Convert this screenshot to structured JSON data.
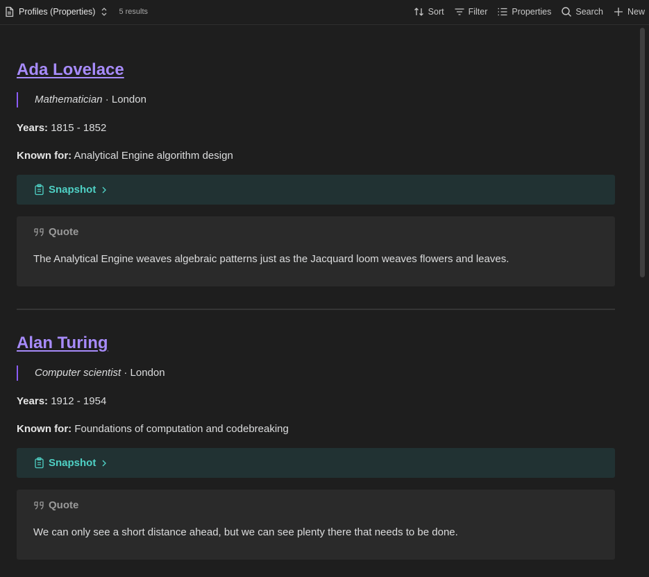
{
  "toolbar": {
    "view_title": "Profiles (Properties)",
    "results": "5 results",
    "sort_label": "Sort",
    "filter_label": "Filter",
    "properties_label": "Properties",
    "search_label": "Search",
    "new_label": "New"
  },
  "entries": [
    {
      "name": "Ada Lovelace",
      "role": "Mathematician",
      "location": " · London",
      "years_label": "Years:",
      "years": " 1815 - 1852",
      "known_label": "Known for:",
      "known": " Analytical Engine algorithm design",
      "snapshot_label": "Snapshot",
      "quote_label": "Quote",
      "quote": "The Analytical Engine weaves algebraic patterns just as the Jacquard loom weaves flowers and leaves."
    },
    {
      "name": "Alan Turing",
      "role": "Computer scientist",
      "location": " · London",
      "years_label": "Years:",
      "years": " 1912 - 1954",
      "known_label": "Known for:",
      "known": " Foundations of computation and codebreaking",
      "snapshot_label": "Snapshot",
      "quote_label": "Quote",
      "quote": "We can only see a short distance ahead, but we can see plenty there that needs to be done."
    }
  ],
  "colors": {
    "background": "#1e1e1e",
    "link": "#a78bfa",
    "accent_bar": "#8b5cf6",
    "snapshot_bg": "#213233",
    "snapshot_text": "#4fd1c5",
    "quote_bg": "#2a2a2a"
  },
  "icons": [
    "document-icon",
    "chevron-updown-icon",
    "sort-icon",
    "filter-icon",
    "properties-icon",
    "search-icon",
    "plus-icon",
    "clipboard-icon",
    "chevron-right-icon",
    "quote-icon"
  ]
}
